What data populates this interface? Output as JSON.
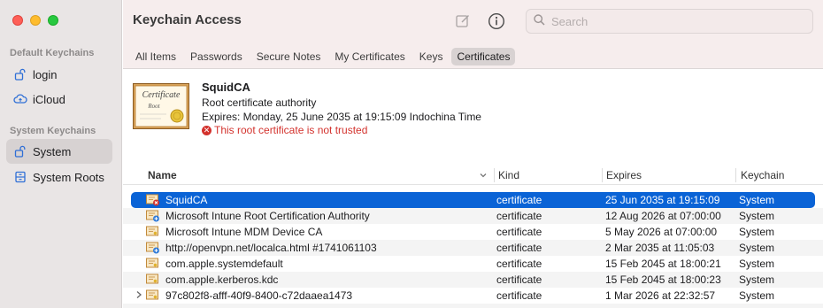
{
  "window": {
    "title": "Keychain Access"
  },
  "sidebar": {
    "default_header": "Default Keychains",
    "system_header": "System Keychains",
    "items": [
      {
        "label": "login",
        "icon": "lock-open-icon"
      },
      {
        "label": "iCloud",
        "icon": "cloud-icon"
      },
      {
        "label": "System",
        "icon": "lock-open-icon",
        "selected": true
      },
      {
        "label": "System Roots",
        "icon": "cabinet-icon"
      }
    ]
  },
  "toolbar": {
    "compose_icon": "compose-icon",
    "info_icon": "info-icon",
    "search_placeholder": "Search"
  },
  "tabs": [
    {
      "label": "All Items"
    },
    {
      "label": "Passwords"
    },
    {
      "label": "Secure Notes"
    },
    {
      "label": "My Certificates"
    },
    {
      "label": "Keys"
    },
    {
      "label": "Certificates",
      "active": true
    }
  ],
  "detail": {
    "cert_image_title": "Certificate",
    "cert_image_subtitle": "Root",
    "name": "SquidCA",
    "type": "Root certificate authority",
    "expires": "Expires: Monday, 25 June 2035 at 19:15:09 Indochina Time",
    "warning": "This root certificate is not trusted"
  },
  "table": {
    "columns": {
      "name": "Name",
      "kind": "Kind",
      "expires": "Expires",
      "keychain": "Keychain"
    },
    "rows": [
      {
        "name": "SquidCA",
        "kind": "certificate",
        "expires": "25 Jun 2035 at 19:15:09",
        "keychain": "System",
        "selected": true,
        "badge": "untrusted"
      },
      {
        "name": "Microsoft Intune Root Certification Authority",
        "kind": "certificate",
        "expires": "12 Aug 2026 at 07:00:00",
        "keychain": "System",
        "badge": "plus"
      },
      {
        "name": "Microsoft Intune MDM Device CA",
        "kind": "certificate",
        "expires": "5 May 2026 at 07:00:00",
        "keychain": "System",
        "badge": "none"
      },
      {
        "name": "http://openvpn.net/localca.html #1741061103",
        "kind": "certificate",
        "expires": "2 Mar 2035 at 11:05:03",
        "keychain": "System",
        "badge": "plus"
      },
      {
        "name": "com.apple.systemdefault",
        "kind": "certificate",
        "expires": "15 Feb 2045 at 18:00:21",
        "keychain": "System",
        "badge": "none"
      },
      {
        "name": "com.apple.kerberos.kdc",
        "kind": "certificate",
        "expires": "15 Feb 2045 at 18:00:23",
        "keychain": "System",
        "badge": "none"
      },
      {
        "name": "97c802f8-afff-40f9-8400-c72daaea1473",
        "kind": "certificate",
        "expires": "1 Mar 2026 at 22:32:57",
        "keychain": "System",
        "badge": "none",
        "expandable": true
      }
    ]
  },
  "colors": {
    "selection": "#0a63d6",
    "warning": "#d3322d",
    "sidebar_bg": "#e9e5e5",
    "toolbar_bg": "#f6eded"
  }
}
